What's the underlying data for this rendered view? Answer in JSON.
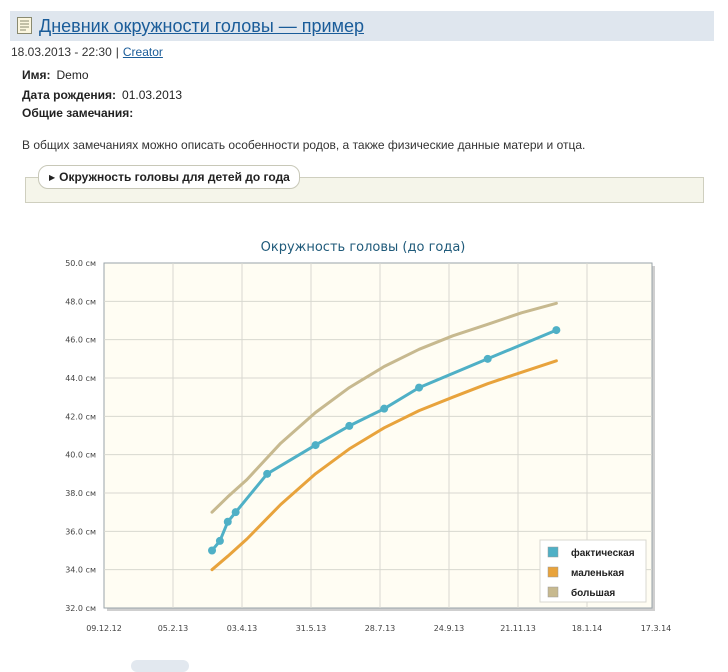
{
  "post": {
    "title": "Дневник окружности головы — пример",
    "date": "18.03.2013 - 22:30",
    "separator": "|",
    "author": "Creator"
  },
  "fields": [
    {
      "label": "Имя:",
      "value": "Demo"
    },
    {
      "label": "Дата рождения:",
      "value": "01.03.2013"
    },
    {
      "label": "Общие замечания:",
      "value": ""
    }
  ],
  "note": "В общих замечаниях можно описать особенности родов, а также физические данные матери и отца.",
  "collapsible": {
    "label": "Окружность головы для детей до года",
    "icon": "triangle-right-icon"
  },
  "colors": {
    "link": "#1a5c99",
    "title_bg": "#dfe6ee",
    "plot_bg": "#fffdf3"
  },
  "chart_data": {
    "type": "line",
    "title": "Окружность головы (до года)",
    "xlabel": "",
    "ylabel": "",
    "x_ticks": [
      "09.12.12",
      "05.2.13",
      "03.4.13",
      "31.5.13",
      "28.7.13",
      "24.9.13",
      "21.11.13",
      "18.1.14",
      "17.3.14"
    ],
    "y_ticks": [
      "32.0 см",
      "34.0 см",
      "36.0 см",
      "38.0 см",
      "40.0 см",
      "42.0 см",
      "44.0 см",
      "46.0 см",
      "48.0 см",
      "50.0 см"
    ],
    "ylim": [
      32,
      50
    ],
    "xlim": [
      "2012-11-25",
      "2014-03-27"
    ],
    "grid": true,
    "legend_position": "bottom-right",
    "series": [
      {
        "name": "фактическая",
        "color": "#4fb0c6",
        "markers": true,
        "points": [
          [
            "2013-03-01",
            35.0
          ],
          [
            "2013-03-08",
            35.5
          ],
          [
            "2013-03-15",
            36.5
          ],
          [
            "2013-03-22",
            37.0
          ],
          [
            "2013-04-19",
            39.0
          ],
          [
            "2013-06-01",
            40.5
          ],
          [
            "2013-07-01",
            41.5
          ],
          [
            "2013-08-01",
            42.4
          ],
          [
            "2013-09-01",
            43.5
          ],
          [
            "2013-11-01",
            45.0
          ],
          [
            "2014-01-01",
            46.5
          ]
        ]
      },
      {
        "name": "маленькая",
        "color": "#e8a33c",
        "markers": false,
        "points": [
          [
            "2013-03-01",
            34.0
          ],
          [
            "2013-03-15",
            34.7
          ],
          [
            "2013-04-01",
            35.6
          ],
          [
            "2013-05-01",
            37.4
          ],
          [
            "2013-06-01",
            39.0
          ],
          [
            "2013-07-01",
            40.3
          ],
          [
            "2013-08-01",
            41.4
          ],
          [
            "2013-09-01",
            42.3
          ],
          [
            "2013-10-01",
            43.0
          ],
          [
            "2013-11-01",
            43.7
          ],
          [
            "2013-12-01",
            44.3
          ],
          [
            "2014-01-01",
            44.9
          ]
        ]
      },
      {
        "name": "большая",
        "color": "#c7b98f",
        "markers": false,
        "points": [
          [
            "2013-03-01",
            37.0
          ],
          [
            "2013-03-15",
            37.8
          ],
          [
            "2013-04-01",
            38.7
          ],
          [
            "2013-05-01",
            40.6
          ],
          [
            "2013-06-01",
            42.2
          ],
          [
            "2013-07-01",
            43.5
          ],
          [
            "2013-08-01",
            44.6
          ],
          [
            "2013-09-01",
            45.5
          ],
          [
            "2013-10-01",
            46.2
          ],
          [
            "2013-11-01",
            46.8
          ],
          [
            "2013-12-01",
            47.4
          ],
          [
            "2014-01-01",
            47.9
          ]
        ]
      }
    ]
  }
}
